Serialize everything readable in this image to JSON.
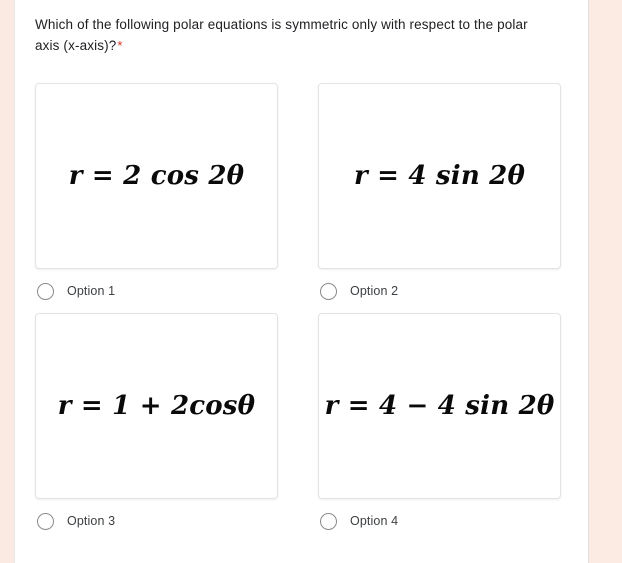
{
  "question": {
    "text": "Which of the following polar equations is symmetric only with respect to the polar axis (x-axis)?",
    "required_marker": "*"
  },
  "options": [
    {
      "equation": "r = 2 cos 2θ",
      "label": "Option 1",
      "selected": false,
      "radio_name": "radio-option-1"
    },
    {
      "equation": "r = 4 sin 2θ",
      "label": "Option 2",
      "selected": false,
      "radio_name": "radio-option-2"
    },
    {
      "equation": "r = 1 + 2cosθ",
      "label": "Option 3",
      "selected": false,
      "radio_name": "radio-option-3"
    },
    {
      "equation": "r = 4 − 4 sin 2θ",
      "label": "Option 4",
      "selected": false,
      "radio_name": "radio-option-4"
    }
  ],
  "colors": {
    "page_background": "#fcebe3",
    "card_background": "#ffffff",
    "question_text": "#202124",
    "required_star": "#d93025",
    "option_label": "#3c4043",
    "equation_text": "#0a0a0a",
    "box_border": "#e3e3e3",
    "radio_border": "#8b8b8b"
  }
}
